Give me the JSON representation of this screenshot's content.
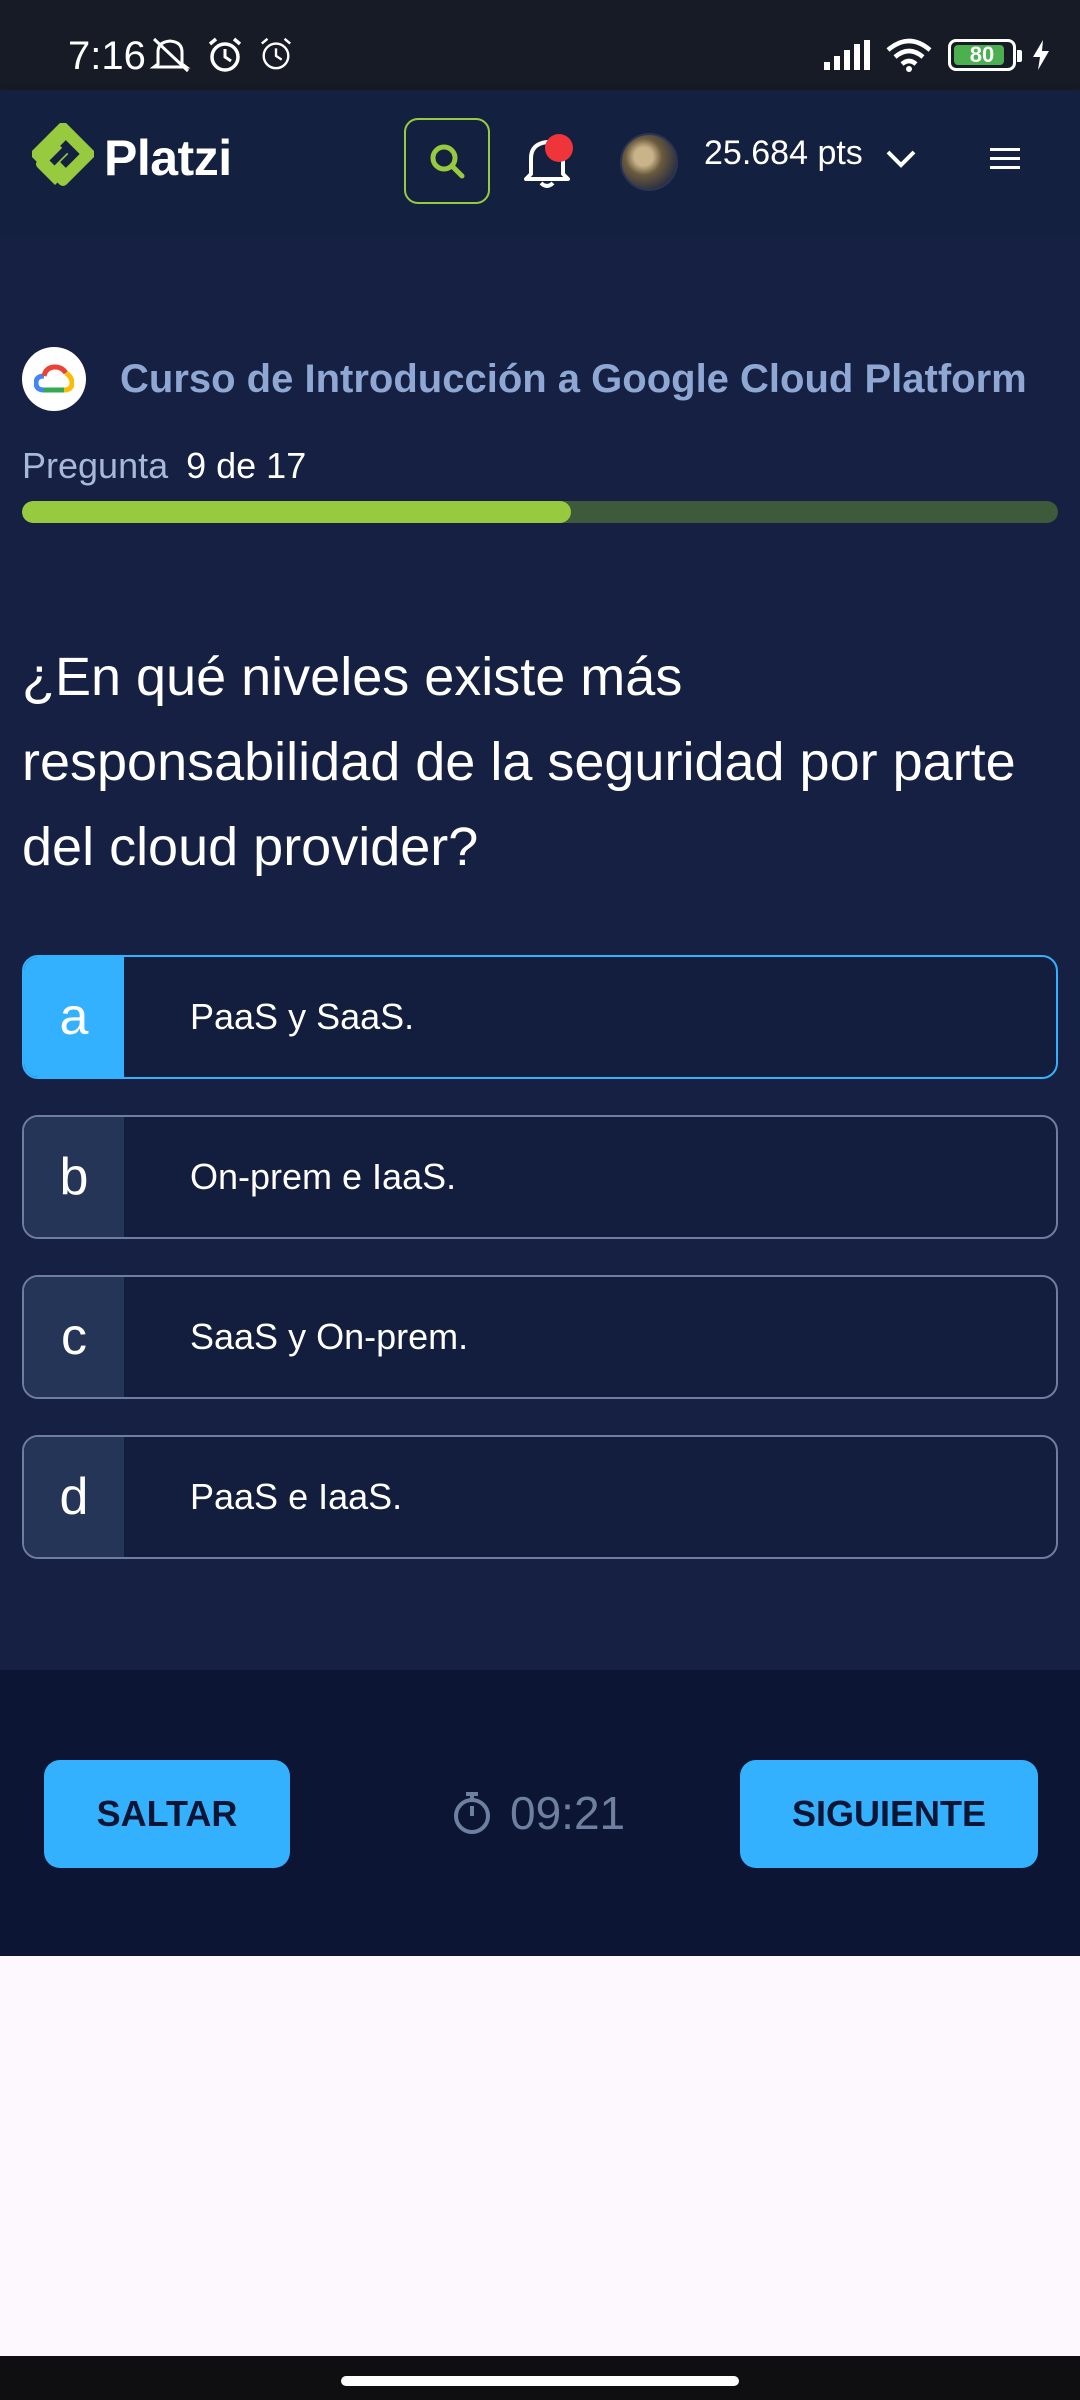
{
  "status_bar": {
    "time": "7:16",
    "battery": "80",
    "icons_left": [
      "mute-icon",
      "alarm-icon",
      "alarm-outline-icon"
    ],
    "icons_right": [
      "signal-icon",
      "wifi-icon",
      "battery-icon",
      "charging-icon"
    ]
  },
  "header": {
    "logo_text": "Platzi",
    "points": "25.684 pts",
    "accent_color": "#98ca3f",
    "notification_dot_color": "#f0353a"
  },
  "quiz": {
    "course_title": "Curso de Introducción a Google Cloud Platform",
    "question_label": "Pregunta",
    "question_progress": "9 de 17",
    "progress_fraction": 0.53,
    "question_text": "¿En qué niveles existe más responsabilidad de la seguridad por parte del cloud provider?",
    "options": [
      {
        "letter": "a",
        "text": "PaaS y SaaS.",
        "selected": true
      },
      {
        "letter": "b",
        "text": "On-prem e IaaS.",
        "selected": false
      },
      {
        "letter": "c",
        "text": "SaaS y On-prem.",
        "selected": false
      },
      {
        "letter": "d",
        "text": "PaaS e IaaS.",
        "selected": false
      }
    ]
  },
  "footer": {
    "skip_label": "SALTAR",
    "timer": "09:21",
    "next_label": "SIGUIENTE",
    "button_color": "#33b1ff"
  }
}
